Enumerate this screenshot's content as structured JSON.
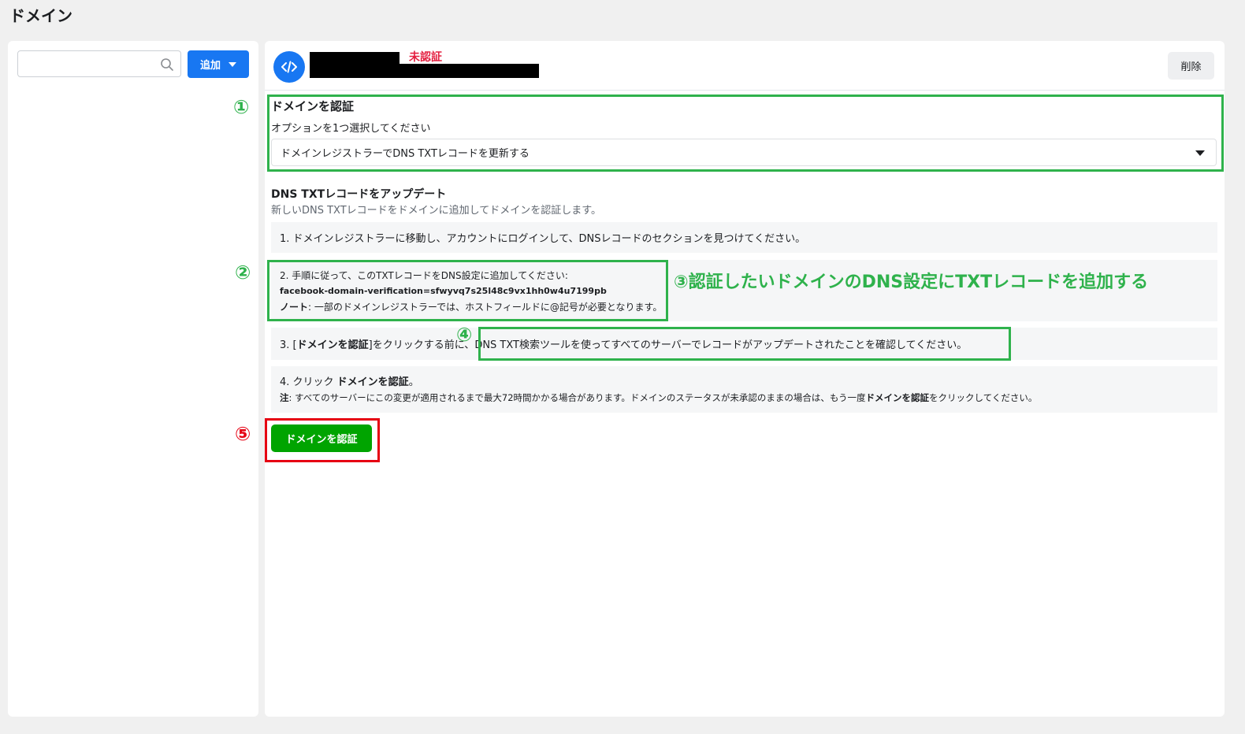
{
  "page": {
    "title": "ドメイン"
  },
  "left_panel": {
    "search": {
      "placeholder": "",
      "icon": "search-icon"
    },
    "add_button": {
      "label": "追加",
      "icon": "caret-down-icon"
    }
  },
  "domain": {
    "icon": "code-icon",
    "status": "未認証",
    "delete_label": "削除"
  },
  "verify_section": {
    "title": "ドメインを認証",
    "option_label": "オプションを1つ選択してください",
    "selected_option": "ドメインレジストラーでDNS TXTレコードを更新する"
  },
  "dns_section": {
    "title": "DNS TXTレコードをアップデート",
    "description": "新しいDNS TXTレコードをドメインに追加してドメインを認証します。"
  },
  "steps": {
    "step1": "1. ドメインレジストラーに移動し、アカウントにログインして、DNSレコードのセクションを見つけてください。",
    "step2_intro": "2. 手順に従って、このTXTレコードをDNS設定に追加してください:",
    "step2_record": "facebook-domain-verification=sfwyvq7s25l48c9vx1hh0w4u7199pb",
    "step2_note_label": "ノート",
    "step2_note": ": 一部のドメインレジストラーでは、ホストフィールドに@記号が必要となります。",
    "step3_prefix": "3. [",
    "step3_bold": "ドメインを認証",
    "step3_middle": "]をクリックする前に、",
    "step3_rest": "DNS TXT検索ツールを使ってすべてのサーバーでレコードがアップデートされたことを確認してください。",
    "step4_prefix": "4. クリック ",
    "step4_bold": "ドメインを認証",
    "step4_suffix": "。",
    "step4_note_label": "注",
    "step4_note_a": ": すべてのサーバーにこの変更が適用されるまで最大72時間かかる場合があります。ドメインのステータスが未承認のままの場合は、もう一度",
    "step4_note_bold": "ドメインを認証",
    "step4_note_b": "をクリックしてください。"
  },
  "verify_button": {
    "label": "ドメインを認証"
  },
  "annotations": {
    "n1": "①",
    "n2": "②",
    "n4": "④",
    "n5": "⑤",
    "callout3": "③認証したいドメインのDNS設定にTXTレコードを追加する",
    "green_color": "#2fb24c",
    "red_color": "#e60012"
  }
}
